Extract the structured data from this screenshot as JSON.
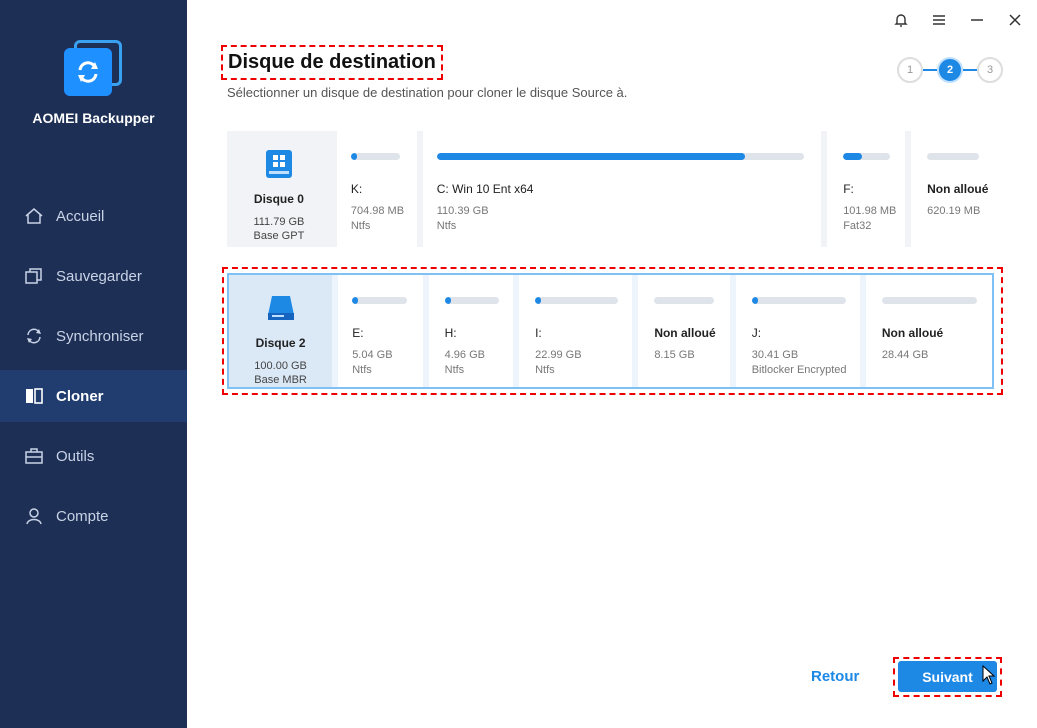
{
  "app": {
    "name": "AOMEI Backupper"
  },
  "sidebar": {
    "items": [
      {
        "label": "Accueil",
        "icon": "home-icon"
      },
      {
        "label": "Sauvegarder",
        "icon": "backup-icon"
      },
      {
        "label": "Synchroniser",
        "icon": "sync-icon"
      },
      {
        "label": "Cloner",
        "icon": "clone-icon",
        "active": true
      },
      {
        "label": "Outils",
        "icon": "tools-icon"
      },
      {
        "label": "Compte",
        "icon": "user-icon"
      }
    ]
  },
  "header": {
    "title": "Disque de destination",
    "subtitle": "Sélectionner un disque de destination pour cloner le disque Source à."
  },
  "steps": [
    "1",
    "2",
    "3"
  ],
  "current_step": 2,
  "disks": [
    {
      "name": "Disque 0",
      "size": "111.79 GB",
      "type": "Base GPT",
      "partitions": [
        {
          "label": "K:",
          "size": "704.98 MB",
          "fs": "Ntfs",
          "usage": 0.05
        },
        {
          "label": "C: Win 10 Ent x64",
          "size": "110.39 GB",
          "fs": "Ntfs",
          "usage": 0.84
        },
        {
          "label": "F:",
          "size": "101.98 MB",
          "fs": "Fat32",
          "usage": 0.4
        },
        {
          "label": "Non alloué",
          "size": "620.19 MB",
          "fs": "",
          "usage": 0
        }
      ]
    },
    {
      "name": "Disque 2",
      "size": "100.00 GB",
      "type": "Base MBR",
      "partitions": [
        {
          "label": "E:",
          "size": "5.04 GB",
          "fs": "Ntfs",
          "usage": 0.05
        },
        {
          "label": "H:",
          "size": "4.96 GB",
          "fs": "Ntfs",
          "usage": 0.05
        },
        {
          "label": "I:",
          "size": "22.99 GB",
          "fs": "Ntfs",
          "usage": 0.05
        },
        {
          "label": "Non alloué",
          "size": "8.15 GB",
          "fs": "",
          "usage": 0
        },
        {
          "label": "J:",
          "size": "30.41 GB",
          "fs": "Bitlocker Encrypted",
          "usage": 0.03
        },
        {
          "label": "Non alloué",
          "size": "28.44 GB",
          "fs": "",
          "usage": 0
        }
      ]
    }
  ],
  "footer": {
    "back_label": "Retour",
    "next_label": "Suivant"
  },
  "colors": {
    "sidebar_bg": "#1d2f55",
    "accent": "#1e88e5",
    "highlight_dash": "#e00000"
  }
}
